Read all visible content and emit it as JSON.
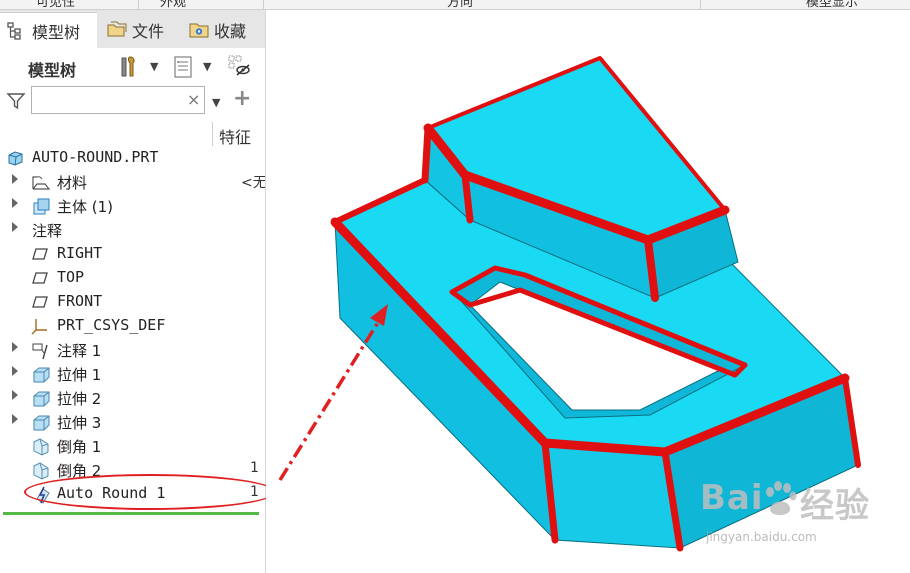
{
  "topbar": {
    "items": [
      "可见性",
      "外观",
      "方向",
      "模型显示"
    ]
  },
  "tabs": [
    {
      "label": "模型树",
      "icon": "model-tree-icon",
      "active": true
    },
    {
      "label": "文件",
      "icon": "folders-icon",
      "active": false
    },
    {
      "label": "收藏",
      "icon": "favorites-icon",
      "active": false
    }
  ],
  "toolbar": {
    "title": "模型树"
  },
  "filter": {
    "value": "",
    "clear": "×",
    "add": "+"
  },
  "columns": {
    "feature": "特征"
  },
  "tree": {
    "root": "AUTO-ROUND.PRT",
    "items": [
      {
        "label": "材料",
        "value": "<无"
      },
      {
        "label": "主体 (1)",
        "value": ""
      },
      {
        "label": "注释",
        "value": ""
      },
      {
        "label": "RIGHT",
        "value": ""
      },
      {
        "label": "TOP",
        "value": ""
      },
      {
        "label": "FRONT",
        "value": ""
      },
      {
        "label": "PRT_CSYS_DEF",
        "value": ""
      },
      {
        "label": "注释 1",
        "value": ""
      },
      {
        "label": "拉伸 1",
        "value": ""
      },
      {
        "label": "拉伸 2",
        "value": ""
      },
      {
        "label": "拉伸 3",
        "value": ""
      },
      {
        "label": "倒角 1",
        "value": ""
      },
      {
        "label": "倒角 2",
        "value": "1"
      },
      {
        "label": "Auto Round 1",
        "value": "1"
      }
    ]
  },
  "watermark": {
    "brand": "Bai\u0001经验",
    "brand_left": "Bai",
    "brand_right": "经验",
    "url": "jingyan.baidu.com"
  },
  "colors": {
    "model_face": "#1ad9f2",
    "model_side": "#11bfe0",
    "round_edge": "#e01010",
    "annotation_red": "#e02020",
    "accent_green": "#57b84a"
  }
}
